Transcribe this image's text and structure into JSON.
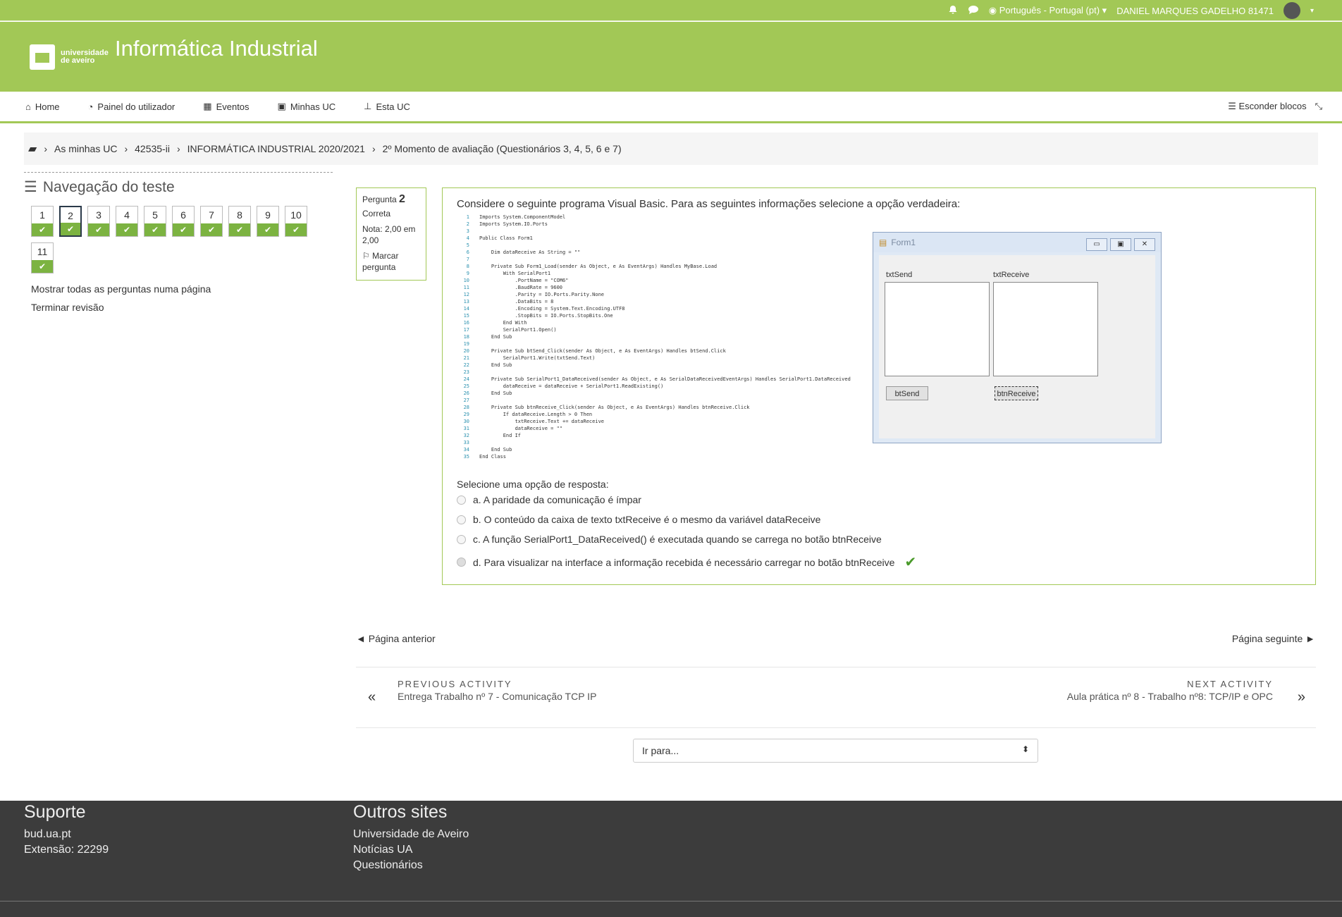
{
  "topbar": {
    "language": "Português - Portugal (pt)",
    "user": "DANIEL MARQUES GADELHO 81471",
    "bell_icon": "bell-icon",
    "chat_icon": "chat-icon",
    "globe_icon": "globe-icon"
  },
  "header": {
    "logo_line1": "universidade",
    "logo_line2": "de aveiro",
    "site_name": "Informática Industrial"
  },
  "nav": {
    "items": [
      "Home",
      "Painel do utilizador",
      "Eventos",
      "Minhas UC",
      "Esta UC"
    ],
    "hide_blocks": "Esconder blocos"
  },
  "breadcrumb": {
    "items": [
      "As minhas UC",
      "42535-ii",
      "INFORMÁTICA INDUSTRIAL 2020/2021",
      "2º Momento de avaliação (Questionários 3, 4, 5, 6 e 7)"
    ]
  },
  "quiz_nav": {
    "title": "Navegação do teste",
    "questions": [
      "1",
      "2",
      "3",
      "4",
      "5",
      "6",
      "7",
      "8",
      "9",
      "10",
      "11"
    ],
    "current": "2",
    "show_all": "Mostrar todas as perguntas numa página",
    "finish": "Terminar revisão"
  },
  "question_info": {
    "label": "Pergunta",
    "number": "2",
    "status": "Correta",
    "grade": "Nota: 2,00 em 2,00",
    "flag": "Marcar pergunta"
  },
  "question": {
    "text": "Considere o seguinte programa Visual Basic. Para as seguintes informações selecione a opção verdadeira:",
    "prompt": "Selecione uma opção de resposta:",
    "options": [
      "a. A paridade da comunicação é ímpar",
      "b. O conteúdo da caixa de texto txtReceive é o mesmo da variável dataReceive",
      "c. A função SerialPort1_DataReceived() é executada quando se carrega no botão btnReceive",
      "d. Para visualizar na interface a informação recebida é necessário carregar no botão btnReceive"
    ],
    "correct_index": 3
  },
  "form1": {
    "title": "Form1",
    "label_send": "txtSend",
    "label_receive": "txtReceive",
    "btn_send": "btSend",
    "btn_receive": "btnReceive"
  },
  "code": {
    "lines": [
      "Imports System.ComponentModel",
      "Imports System.IO.Ports",
      "",
      "Public Class Form1",
      "",
      "    Dim dataReceive As String = \"\"",
      "",
      "    Private Sub Form1_Load(sender As Object, e As EventArgs) Handles MyBase.Load",
      "        With SerialPort1",
      "            .PortName = \"COM6\"",
      "            .BaudRate = 9600",
      "            .Parity = IO.Ports.Parity.None",
      "            .DataBits = 8",
      "            .Encoding = System.Text.Encoding.UTF8",
      "            .StopBits = IO.Ports.StopBits.One",
      "        End With",
      "        SerialPort1.Open()",
      "    End Sub",
      "",
      "    Private Sub btSend_Click(sender As Object, e As EventArgs) Handles btSend.Click",
      "        SerialPort1.Write(txtSend.Text)",
      "    End Sub",
      "",
      "    Private Sub SerialPort1_DataReceived(sender As Object, e As SerialDataReceivedEventArgs) Handles SerialPort1.DataReceived",
      "        dataReceive = dataReceive + SerialPort1.ReadExisting()",
      "    End Sub",
      "",
      "    Private Sub btnReceive_Click(sender As Object, e As EventArgs) Handles btnReceive.Click",
      "        If dataReceive.Length > 0 Then",
      "            txtReceive.Text += dataReceive",
      "            dataReceive = \"\"",
      "        End If",
      "",
      "    End Sub",
      "End Class"
    ]
  },
  "pagination": {
    "prev": "◄ Página anterior",
    "next": "Página seguinte ►"
  },
  "activities": {
    "prev_caption": "PREVIOUS ACTIVITY",
    "prev_title": "Entrega Trabalho nº 7 - Comunicação TCP IP",
    "next_caption": "NEXT ACTIVITY",
    "next_title": "Aula prática nº 8 - Trabalho nº8: TCP/IP e OPC"
  },
  "goto": {
    "placeholder": "Ir para..."
  },
  "footer": {
    "support_title": "Suporte",
    "support_lines": [
      "bud.ua.pt",
      "Extensão: 22299"
    ],
    "other_title": "Outros sites",
    "other_lines": [
      "Universidade de Aveiro",
      "Notícias UA",
      "Questionários"
    ]
  },
  "colors": {
    "brand": "#a2c856",
    "success": "#7cb341",
    "footer_bg": "#3c3c3c"
  }
}
